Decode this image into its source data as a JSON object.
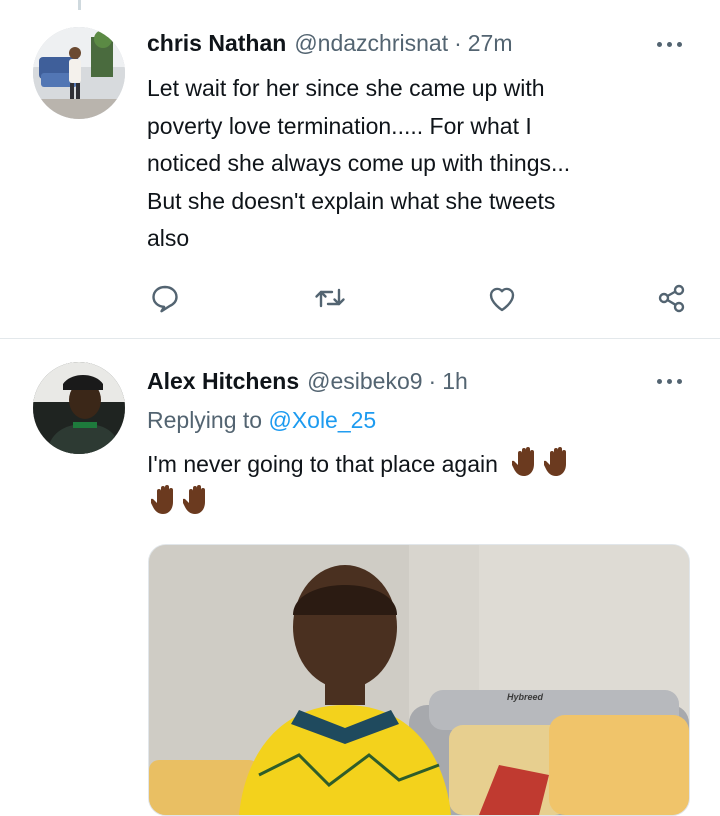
{
  "tweets": [
    {
      "author": "chris Nathan",
      "handle": "@ndazchrisnat",
      "separator": "·",
      "time": "27m",
      "lines": [
        "Let wait for her since she came up with",
        "poverty love termination..... For what I",
        "noticed she always come up with things...",
        "But she doesn't explain what she tweets",
        "also"
      ],
      "actions": [
        "reply-icon",
        "retweet-icon",
        "like-icon",
        "share-icon"
      ]
    },
    {
      "author": "Alex Hitchens",
      "handle": "@esibeko9",
      "separator": "·",
      "time": "1h",
      "replying_prefix": "Replying to",
      "replying_to": "@Xole_25",
      "text": "I'm never going to that place again",
      "emoji": "raised-hand-dark-skin-tone",
      "media_watermark": "Hybreed"
    }
  ],
  "colors": {
    "text": "#0f1419",
    "secondary": "#536471",
    "link": "#1d9bf0",
    "divider": "#e3e8eb"
  }
}
